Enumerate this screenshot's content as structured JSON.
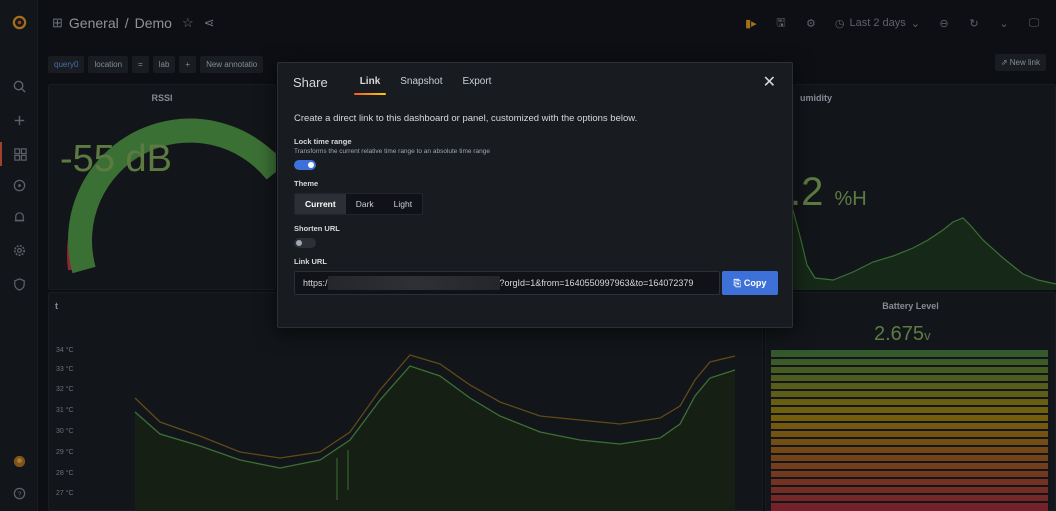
{
  "breadcrumb": {
    "folder": "General",
    "separator": "/",
    "dashboard": "Demo"
  },
  "toolbar": {
    "time_range": "Last 2 days"
  },
  "variables": {
    "query_label": "query0",
    "location_label": "location",
    "location_value": "lab",
    "new_annotation": "New annotatio"
  },
  "new_link": "New link",
  "panels": {
    "rssi": {
      "title": "RSSI",
      "value": "-55 dB"
    },
    "humidity": {
      "title": "umidity",
      "value": ".2",
      "unit": "%H"
    },
    "battery": {
      "title": "Battery Level",
      "value": "2.675",
      "unit": "v"
    },
    "temperature": {
      "title": "t",
      "y_ticks": [
        "34 °C",
        "33 °C",
        "32 °C",
        "31 °C",
        "30 °C",
        "29 °C",
        "28 °C",
        "27 °C"
      ]
    }
  },
  "share_modal": {
    "title": "Share",
    "tabs": [
      "Link",
      "Snapshot",
      "Export"
    ],
    "active_tab": "Link",
    "intro": "Create a direct link to this dashboard or panel, customized with the options below.",
    "lock_time_label": "Lock time range",
    "lock_time_desc": "Transforms the current relative time range to an absolute time range",
    "lock_time_on": true,
    "theme_label": "Theme",
    "theme_options": [
      "Current",
      "Dark",
      "Light"
    ],
    "theme_selected": "Current",
    "shorten_label": "Shorten URL",
    "shorten_on": false,
    "link_label": "Link URL",
    "link_prefix": "https:/",
    "link_suffix": "?orgId=1&from=1640550997963&to=164072379",
    "copy_label": "Copy"
  },
  "colors": {
    "accent_blue": "#3d71d9",
    "value_green": "#8ab65f",
    "tab_underline": "#f05a28",
    "gauge_red": "#e02f44"
  }
}
